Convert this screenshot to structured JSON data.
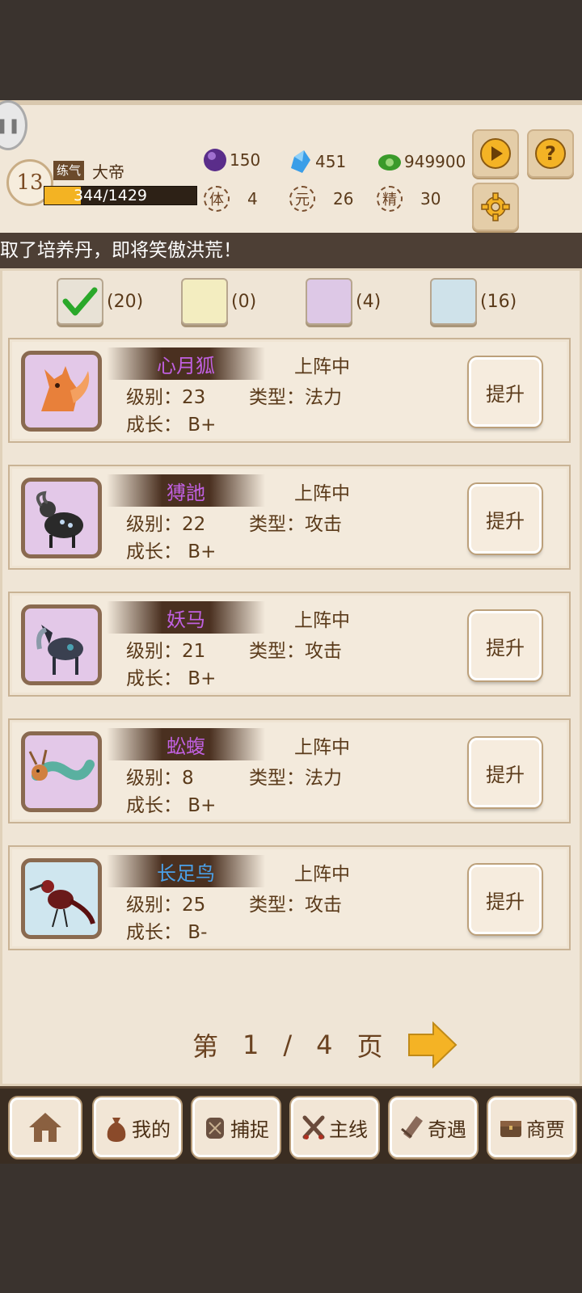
{
  "header": {
    "level": "13",
    "rank": "练气",
    "title": "大帝",
    "exp_text": "344/1429",
    "exp_ratio": 0.24,
    "resources": [
      {
        "icon": "purple-orb-icon",
        "value": "150"
      },
      {
        "icon": "blue-crystal-icon",
        "value": "451"
      },
      {
        "icon": "green-jade-icon",
        "value": "949900"
      }
    ],
    "stats": [
      {
        "glyph": "体",
        "value": "4"
      },
      {
        "glyph": "元",
        "value": "26"
      },
      {
        "glyph": "精",
        "value": "30"
      }
    ],
    "buttons": [
      "play-icon",
      "help-icon",
      "gear-icon"
    ]
  },
  "marquee": "取了培养丹，即将笑傲洪荒！",
  "filters": [
    {
      "color": "#e8e2d6",
      "count": "(20)",
      "checked": true
    },
    {
      "color": "#f3edc0",
      "count": "(0)",
      "checked": false
    },
    {
      "color": "#ddc8e6",
      "count": "(4)",
      "checked": false
    },
    {
      "color": "#cfe2ea",
      "count": "(16)",
      "checked": false
    }
  ],
  "pets": [
    {
      "name": "心月狐",
      "name_color": "#c060e0",
      "status": "上阵中",
      "level": "级别：23",
      "type": "类型：法力",
      "growth": "成长：  B+",
      "bg": "#e3c8e8",
      "icon": "fox-icon"
    },
    {
      "name": "猼訑",
      "name_color": "#c060e0",
      "status": "上阵中",
      "level": "级别：22",
      "type": "类型：攻击",
      "growth": "成长：  B+",
      "bg": "#e3c8e8",
      "icon": "goat-beast-icon"
    },
    {
      "name": "妖马",
      "name_color": "#c060e0",
      "status": "上阵中",
      "level": "级别：21",
      "type": "类型：攻击",
      "growth": "成长：  B+",
      "bg": "#e3c8e8",
      "icon": "horse-beast-icon"
    },
    {
      "name": "蚣蝮",
      "name_color": "#c060e0",
      "status": "上阵中",
      "level": "级别：8",
      "type": "类型：法力",
      "growth": "成长：  B+",
      "bg": "#e3c8e8",
      "icon": "dragon-icon"
    },
    {
      "name": "长足鸟",
      "name_color": "#4aa0e8",
      "status": "上阵中",
      "level": "级别：25",
      "type": "类型：攻击",
      "growth": "成长：  B-",
      "bg": "#cfe6ef",
      "icon": "bird-icon"
    }
  ],
  "upgrade_label": "提升",
  "pager": {
    "prefix": "第",
    "current": "1",
    "sep": "/",
    "total": "4",
    "suffix": "页"
  },
  "nav": [
    {
      "label": "",
      "icon": "home-icon"
    },
    {
      "label": "我的",
      "icon": "bag-icon"
    },
    {
      "label": "捕捉",
      "icon": "net-icon"
    },
    {
      "label": "主线",
      "icon": "swords-icon"
    },
    {
      "label": "奇遇",
      "icon": "scroll-icon"
    },
    {
      "label": "商贾",
      "icon": "chest-icon"
    }
  ]
}
